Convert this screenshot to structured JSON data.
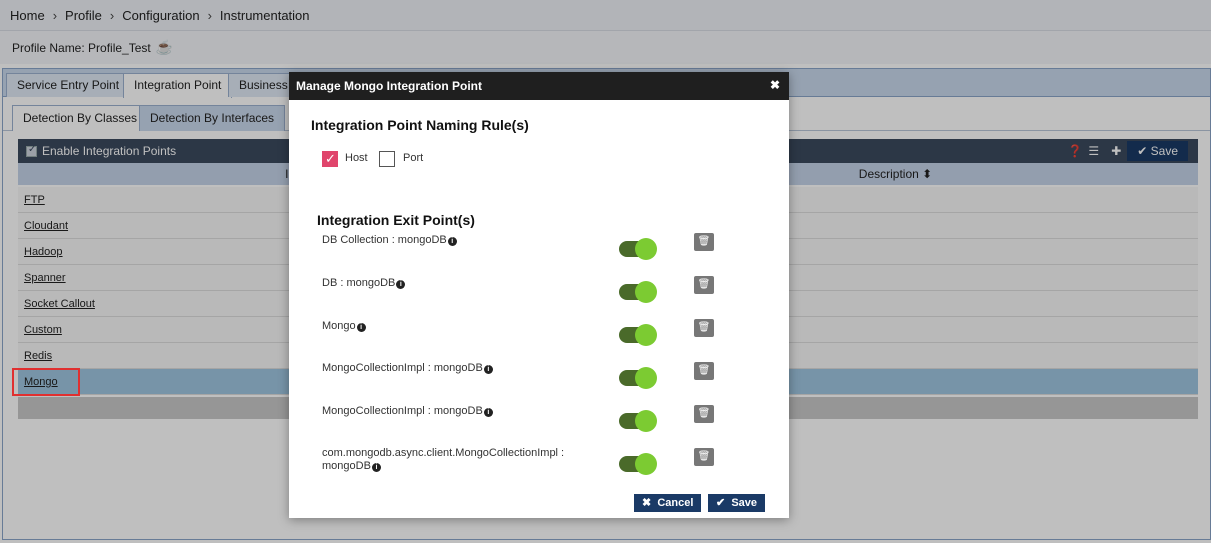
{
  "breadcrumb": {
    "items": [
      "Home",
      "Profile",
      "Configuration",
      "Instrumentation"
    ]
  },
  "profile": {
    "label": "Profile Name: Profile_Test",
    "icon": "java-icon"
  },
  "tabs": [
    {
      "label": "Service Entry Point"
    },
    {
      "label": "Integration Point"
    },
    {
      "label": "Business T"
    }
  ],
  "subtabs": [
    {
      "label": "Detection By Classes"
    },
    {
      "label": "Detection By Interfaces"
    }
  ],
  "grid": {
    "enable_label": "Enable Integration Points",
    "save_label": "Save",
    "col_integration": "Integrat",
    "col_description": "Description ⬍",
    "rows": [
      "FTP",
      "Cloudant",
      "Hadoop",
      "Spanner",
      "Socket Callout",
      "Custom",
      "Redis",
      "Mongo"
    ]
  },
  "modal": {
    "title": "Manage Mongo Integration Point",
    "close": "✖",
    "naming_title": "Integration Point Naming Rule(s)",
    "host_label": "Host",
    "port_label": "Port",
    "host_checked": true,
    "port_checked": false,
    "exit_title": "Integration Exit Point(s)",
    "exit_points": [
      {
        "label": "DB Collection : mongoDB",
        "enabled": true
      },
      {
        "label": "DB : mongoDB",
        "enabled": true
      },
      {
        "label": "Mongo",
        "enabled": true
      },
      {
        "label": "MongoCollectionImpl : mongoDB",
        "enabled": true
      },
      {
        "label": "MongoCollectionImpl : mongoDB",
        "enabled": true
      },
      {
        "label": "com.mongodb.async.client.MongoCollectionImpl : mongoDB",
        "enabled": true
      }
    ],
    "cancel_label": "Cancel",
    "save_label": "Save"
  },
  "colors": {
    "accent": "#1a3a66",
    "toggle_on": "#7ccb32",
    "checkbox_on": "#e0456c",
    "highlight": "#e03030"
  }
}
